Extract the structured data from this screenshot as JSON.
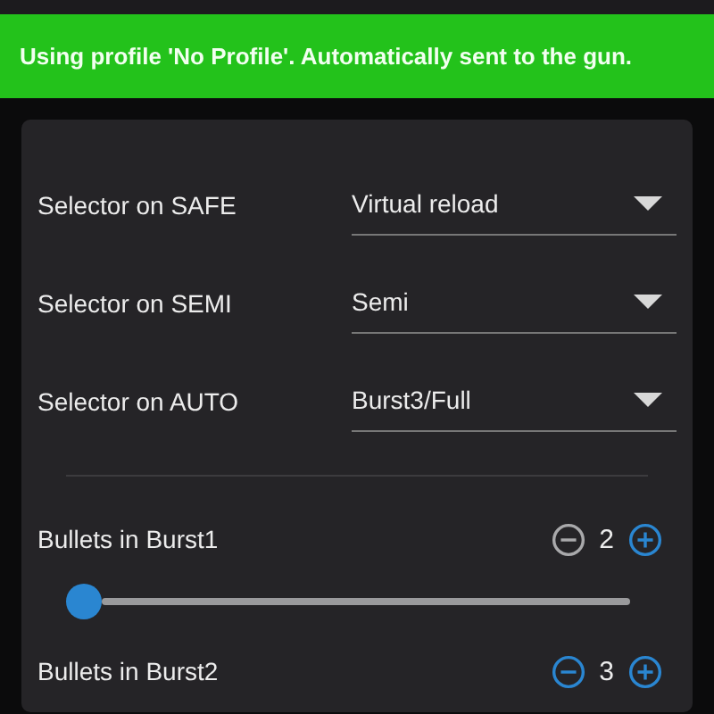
{
  "banner": {
    "text": "Using profile 'No Profile'. Automatically sent to the gun."
  },
  "selectors": [
    {
      "label": "Selector on SAFE",
      "value": "Virtual reload"
    },
    {
      "label": "Selector on SEMI",
      "value": "Semi"
    },
    {
      "label": "Selector on AUTO",
      "value": "Burst3/Full"
    }
  ],
  "counters": [
    {
      "label": "Bullets in Burst1",
      "value": "2",
      "minus_disabled": true,
      "slider": {
        "level": 0
      }
    },
    {
      "label": "Bullets in Burst2",
      "value": "3",
      "minus_disabled": false
    }
  ]
}
